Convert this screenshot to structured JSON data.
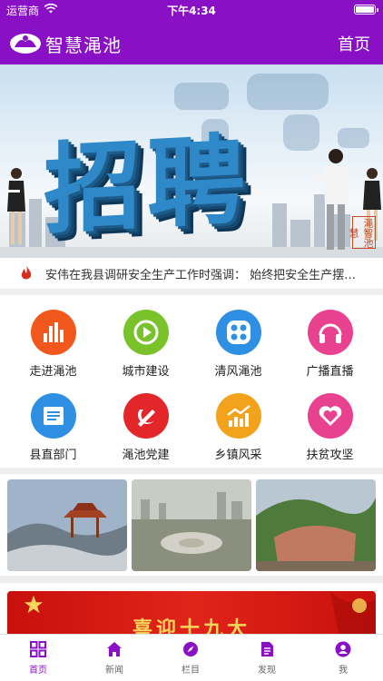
{
  "status_bar": {
    "carrier": "运营商",
    "time": "下午4:34"
  },
  "header": {
    "title": "智慧渑池",
    "home_label": "首页"
  },
  "banner": {
    "headline": "招聘",
    "stamp": "渑智池慧"
  },
  "ticker": {
    "text": "安伟在我县调研安全生产工作时强调： 始终把安全生产摆在首位"
  },
  "grid": {
    "items": [
      {
        "label": "走进渑池",
        "color": "#f2581b",
        "icon": "bar-chart-icon"
      },
      {
        "label": "城市建设",
        "color": "#7ac22a",
        "icon": "play-icon"
      },
      {
        "label": "清风渑池",
        "color": "#2e8fe3",
        "icon": "dots-icon"
      },
      {
        "label": "广播直播",
        "color": "#e8418f",
        "icon": "headphones-icon"
      },
      {
        "label": "县直部门",
        "color": "#2e8fe3",
        "icon": "document-icon"
      },
      {
        "label": "渑池党建",
        "color": "#e3262a",
        "icon": "party-emblem-icon"
      },
      {
        "label": "乡镇风采",
        "color": "#f2a31b",
        "icon": "trend-up-icon"
      },
      {
        "label": "扶贫攻坚",
        "color": "#e8418f",
        "icon": "heart-icon"
      }
    ]
  },
  "promo": {
    "text": "喜迎十九大"
  },
  "tabbar": {
    "items": [
      {
        "label": "首页",
        "icon": "grid-icon",
        "active": true
      },
      {
        "label": "新闻",
        "icon": "house-icon",
        "active": false
      },
      {
        "label": "栏目",
        "icon": "compass-icon",
        "active": false
      },
      {
        "label": "发现",
        "icon": "document-icon",
        "active": false
      },
      {
        "label": "我",
        "icon": "person-icon",
        "active": false
      }
    ]
  },
  "colors": {
    "brand": "#8a10c6",
    "accent_blue": "#2f89c9",
    "promo_red": "#d8150f"
  }
}
